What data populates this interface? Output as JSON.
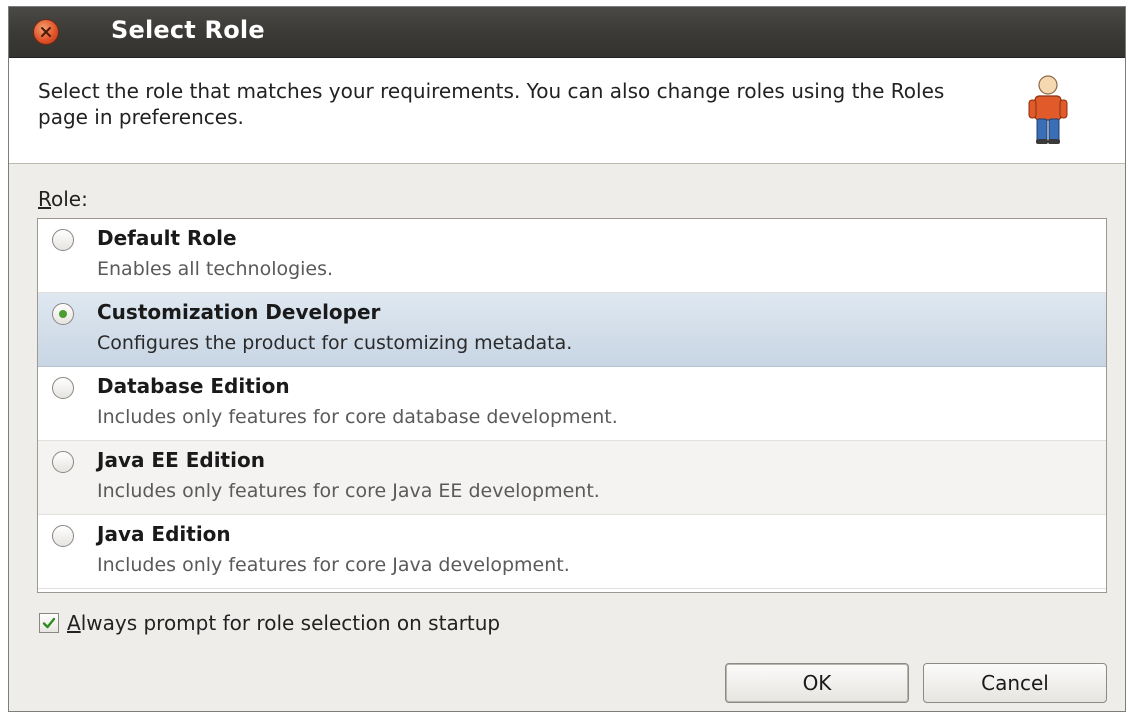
{
  "window": {
    "title": "Select Role"
  },
  "header": {
    "text": "Select the role that matches your requirements. You can also change roles using the Roles page in preferences."
  },
  "role_label": {
    "mnemonic": "R",
    "rest": "ole:"
  },
  "roles": [
    {
      "title": "Default Role",
      "description": "Enables all technologies.",
      "selected": false
    },
    {
      "title": "Customization Developer",
      "description": "Configures the product for customizing metadata.",
      "selected": true
    },
    {
      "title": "Database Edition",
      "description": "Includes only features for core database development.",
      "selected": false
    },
    {
      "title": "Java EE Edition",
      "description": "Includes only features for core Java EE development.",
      "selected": false
    },
    {
      "title": "Java Edition",
      "description": "Includes only features for core Java development.",
      "selected": false
    }
  ],
  "always_prompt": {
    "mnemonic": "A",
    "rest": "lways prompt for role selection on startup",
    "checked": true
  },
  "buttons": {
    "ok": "OK",
    "cancel": "Cancel"
  },
  "icons": {
    "close": "close-icon",
    "role": "person-role-icon",
    "check": "check-icon"
  },
  "colors": {
    "titlebar": "#3a3935",
    "close_button": "#e2542a",
    "selection": "#c8d5e3",
    "radio_dot": "#4a9e2f"
  }
}
